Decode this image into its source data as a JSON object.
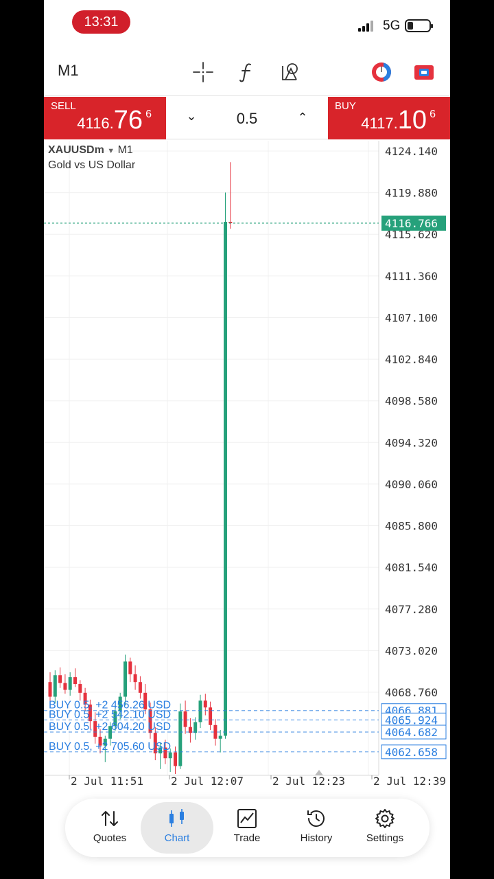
{
  "status": {
    "time": "13:31",
    "network": "5G"
  },
  "toolbar": {
    "timeframe": "M1",
    "icons": [
      "crosshair-icon",
      "indicator-icon",
      "objects-icon",
      "broker-icon",
      "account-icon"
    ]
  },
  "trade": {
    "sell_label": "SELL",
    "sell_price_main": "4116.",
    "sell_price_big": "76",
    "sell_price_sup": "6",
    "buy_label": "BUY",
    "buy_price_main": "4117.",
    "buy_price_big": "10",
    "buy_price_sup": "6",
    "volume": "0.5"
  },
  "chart": {
    "symbol": "XAUUSDm",
    "timeframe": "M1",
    "description": "Gold vs US Dollar",
    "current_price_label": "4116.766"
  },
  "chart_data": {
    "type": "candlestick",
    "ylim": [
      4060.0,
      4125.5
    ],
    "y_ticks": [
      "4124.140",
      "4119.880",
      "4115.620",
      "4111.360",
      "4107.100",
      "4102.840",
      "4098.580",
      "4094.320",
      "4090.060",
      "4085.800",
      "4081.540",
      "4077.280",
      "4073.020",
      "4068.760"
    ],
    "x_ticks": [
      "2 Jul 11:51",
      "2 Jul 12:07",
      "2 Jul 12:23",
      "2 Jul 12:39"
    ],
    "current_price": 4116.766,
    "colors": {
      "up": "#26a17b",
      "down": "#e5323e",
      "order": "#2b7fe0",
      "current": "#26a17b"
    },
    "order_lines": [
      {
        "price": 4066.881,
        "label": "BUY 0.5, +2 456.26 USD",
        "price_label": "4066.881"
      },
      {
        "price": 4065.924,
        "label": "BUY 0.5, +2 542.10 USD",
        "price_label": "4065.924"
      },
      {
        "price": 4064.682,
        "label": "BUY 0.5, +2 604.20 USD",
        "price_label": "4064.682"
      },
      {
        "price": 4062.658,
        "label": "BUY 0.5, +2 705.60 USD",
        "price_label": "4062.658"
      }
    ],
    "candles": [
      [
        4069.8,
        4070.8,
        4067.7,
        4068.3
      ],
      [
        4068.3,
        4071.0,
        4067.6,
        4070.5
      ],
      [
        4070.5,
        4071.3,
        4069.2,
        4069.7
      ],
      [
        4069.7,
        4070.6,
        4068.6,
        4069.0
      ],
      [
        4069.0,
        4070.8,
        4068.4,
        4070.3
      ],
      [
        4070.3,
        4071.2,
        4069.3,
        4069.6
      ],
      [
        4069.6,
        4070.0,
        4067.9,
        4068.7
      ],
      [
        4068.7,
        4069.2,
        4066.8,
        4067.5
      ],
      [
        4067.5,
        4068.0,
        4065.0,
        4065.8
      ],
      [
        4065.8,
        4066.7,
        4063.5,
        4064.2
      ],
      [
        4064.2,
        4065.0,
        4062.5,
        4063.3
      ],
      [
        4063.3,
        4064.3,
        4061.6,
        4064.0
      ],
      [
        4064.0,
        4065.7,
        4063.3,
        4065.3
      ],
      [
        4065.3,
        4067.2,
        4064.8,
        4066.8
      ],
      [
        4066.8,
        4068.7,
        4066.0,
        4068.3
      ],
      [
        4068.3,
        4072.6,
        4067.4,
        4071.9
      ],
      [
        4071.9,
        4072.3,
        4069.8,
        4070.6
      ],
      [
        4070.6,
        4071.5,
        4069.0,
        4069.8
      ],
      [
        4069.8,
        4070.4,
        4068.1,
        4068.7
      ],
      [
        4068.7,
        4069.6,
        4066.5,
        4067.0
      ],
      [
        4067.0,
        4067.7,
        4064.0,
        4064.6
      ],
      [
        4064.6,
        4065.2,
        4061.8,
        4062.5
      ],
      [
        4062.5,
        4063.6,
        4060.9,
        4063.1
      ],
      [
        4063.1,
        4063.9,
        4061.4,
        4062.0
      ],
      [
        4062.0,
        4063.0,
        4060.6,
        4062.6
      ],
      [
        4062.6,
        4063.2,
        4060.4,
        4061.2
      ],
      [
        4061.2,
        4067.6,
        4060.9,
        4066.8
      ],
      [
        4066.8,
        4067.9,
        4064.5,
        4065.2
      ],
      [
        4065.2,
        4066.1,
        4063.6,
        4064.6
      ],
      [
        4064.6,
        4066.2,
        4063.9,
        4065.7
      ],
      [
        4065.7,
        4068.5,
        4065.1,
        4067.9
      ],
      [
        4067.9,
        4068.6,
        4066.4,
        4067.2
      ],
      [
        4067.2,
        4067.8,
        4064.9,
        4065.4
      ],
      [
        4065.4,
        4066.0,
        4063.3,
        4064.0
      ],
      [
        4064.0,
        4064.9,
        4062.6,
        4064.3
      ],
      [
        4064.3,
        4119.9,
        4064.0,
        4116.9
      ],
      [
        4116.9,
        4123.0,
        4116.2,
        4116.766
      ]
    ]
  },
  "nav": {
    "quotes": "Quotes",
    "chart": "Chart",
    "trade": "Trade",
    "history": "History",
    "settings": "Settings"
  }
}
